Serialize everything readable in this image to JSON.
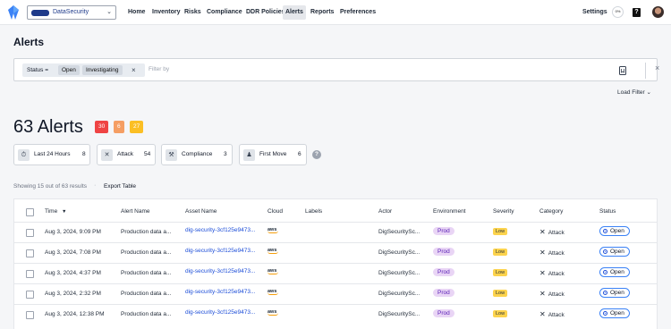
{
  "nav": {
    "org_name": "DataSecurity",
    "items": [
      "Home",
      "Inventory",
      "Risks",
      "Compliance",
      "DDR Policies",
      "Alerts",
      "Reports",
      "Preferences"
    ],
    "active": "Alerts",
    "settings": "Settings",
    "progress": "0%",
    "help": "?"
  },
  "page": {
    "title": "Alerts"
  },
  "filter": {
    "chip_label": "Status =",
    "chip_values": [
      "Open",
      "Investigating"
    ],
    "placeholder": "Filter by",
    "load_filter": "Load Filter"
  },
  "summary": {
    "count_label": "63 Alerts",
    "severity_badges": [
      {
        "value": "30",
        "color": "#ef4444"
      },
      {
        "value": "6",
        "color": "#f59e63"
      },
      {
        "value": "27",
        "color": "#fbbf24"
      }
    ],
    "quick_filters": [
      {
        "icon": "clock-icon",
        "label": "Last 24 Hours",
        "count": "8"
      },
      {
        "icon": "attack-icon",
        "label": "Attack",
        "count": "54"
      },
      {
        "icon": "wrench-icon",
        "label": "Compliance",
        "count": "3"
      },
      {
        "icon": "first-move-icon",
        "label": "First Move",
        "count": "6"
      }
    ]
  },
  "results": {
    "showing": "Showing 15 out of 63 results",
    "export": "Export Table"
  },
  "table": {
    "columns": [
      "Time",
      "Alert Name",
      "Asset Name",
      "Cloud",
      "Labels",
      "Actor",
      "Environment",
      "Severity",
      "Category",
      "Status"
    ],
    "rows": [
      {
        "time": "Aug 3, 2024, 9:09 PM",
        "alert": "Production data a...",
        "asset": "dig-security-3cf125e9473...",
        "cloud": "aws",
        "actor": "DigSecuritySc...",
        "env": "Prod",
        "severity": "Low",
        "category": "Attack",
        "status": "Open"
      },
      {
        "time": "Aug 3, 2024, 7:08 PM",
        "alert": "Production data a...",
        "asset": "dig-security-3cf125e9473...",
        "cloud": "aws",
        "actor": "DigSecuritySc...",
        "env": "Prod",
        "severity": "Low",
        "category": "Attack",
        "status": "Open"
      },
      {
        "time": "Aug 3, 2024, 4:37 PM",
        "alert": "Production data a...",
        "asset": "dig-security-3cf125e9473...",
        "cloud": "aws",
        "actor": "DigSecuritySc...",
        "env": "Prod",
        "severity": "Low",
        "category": "Attack",
        "status": "Open"
      },
      {
        "time": "Aug 3, 2024, 2:32 PM",
        "alert": "Production data a...",
        "asset": "dig-security-3cf125e9473...",
        "cloud": "aws",
        "actor": "DigSecuritySc...",
        "env": "Prod",
        "severity": "Low",
        "category": "Attack",
        "status": "Open"
      },
      {
        "time": "Aug 3, 2024, 12:38 PM",
        "alert": "Production data a...",
        "asset": "dig-security-3cf125e9473...",
        "cloud": "aws",
        "actor": "DigSecuritySc...",
        "env": "Prod",
        "severity": "Low",
        "category": "Attack",
        "status": "Open"
      }
    ]
  }
}
